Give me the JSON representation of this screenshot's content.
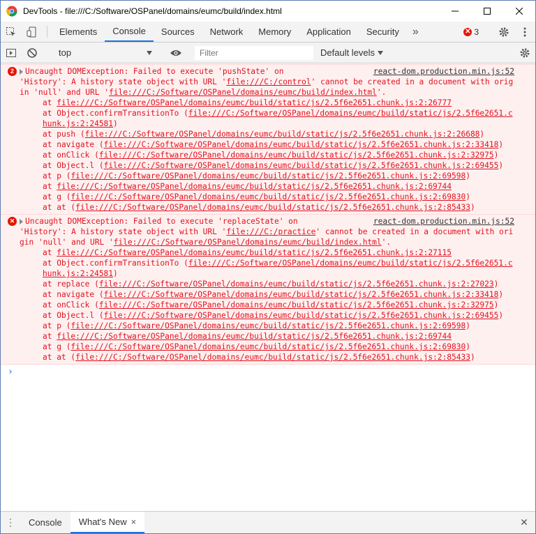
{
  "window": {
    "title": "DevTools - file:///C:/Software/OSPanel/domains/eumc/build/index.html",
    "minimize": "—",
    "maximize": "☐",
    "close": "✕"
  },
  "tabs": [
    {
      "label": "Elements"
    },
    {
      "label": "Console"
    },
    {
      "label": "Sources"
    },
    {
      "label": "Network"
    },
    {
      "label": "Memory"
    },
    {
      "label": "Application"
    },
    {
      "label": "Security"
    }
  ],
  "more_tabs": "»",
  "error_count": "3",
  "toolbar": {
    "context": "top",
    "filter_placeholder": "Filter",
    "levels": "Default levels"
  },
  "messages": [
    {
      "count": "2",
      "header": "Uncaught DOMException: Failed to execute 'pushState' on",
      "source": "react-dom.production.min.js:52",
      "body": [
        {
          "t": "'History': A history state object with URL '"
        },
        {
          "t": "file:///C:/control",
          "u": true
        },
        {
          "t": "' cannot be created in a document with origin 'null' and URL '"
        },
        {
          "t": "file:///C:/Software/OSPanel/domains/eumc/build/index.html",
          "u": true
        },
        {
          "t": "'."
        }
      ],
      "stack": [
        {
          "fn": "at ",
          "loc": "file:///C:/Software/OSPanel/domains/eumc/build/static/js/2.5f6e2651.chunk.js:2:26777",
          "paren": false
        },
        {
          "fn": "at Object.confirmTransitionTo ",
          "loc": "file:///C:/Software/OSPanel/domains/eumc/build/static/js/2.5f6e2651.chunk.js:2:24581",
          "paren": true
        },
        {
          "fn": "at push ",
          "loc": "file:///C:/Software/OSPanel/domains/eumc/build/static/js/2.5f6e2651.chunk.js:2:26688",
          "paren": true
        },
        {
          "fn": "at navigate ",
          "loc": "file:///C:/Software/OSPanel/domains/eumc/build/static/js/2.5f6e2651.chunk.js:2:33418",
          "paren": true
        },
        {
          "fn": "at onClick ",
          "loc": "file:///C:/Software/OSPanel/domains/eumc/build/static/js/2.5f6e2651.chunk.js:2:32975",
          "paren": true
        },
        {
          "fn": "at Object.l ",
          "loc": "file:///C:/Software/OSPanel/domains/eumc/build/static/js/2.5f6e2651.chunk.js:2:69455",
          "paren": true
        },
        {
          "fn": "at p ",
          "loc": "file:///C:/Software/OSPanel/domains/eumc/build/static/js/2.5f6e2651.chunk.js:2:69598",
          "paren": true
        },
        {
          "fn": "at ",
          "loc": "file:///C:/Software/OSPanel/domains/eumc/build/static/js/2.5f6e2651.chunk.js:2:69744",
          "paren": false
        },
        {
          "fn": "at g ",
          "loc": "file:///C:/Software/OSPanel/domains/eumc/build/static/js/2.5f6e2651.chunk.js:2:69830",
          "paren": true
        },
        {
          "fn": "at at ",
          "loc": "file:///C:/Software/OSPanel/domains/eumc/build/static/js/2.5f6e2651.chunk.js:2:85433",
          "paren": true
        }
      ]
    },
    {
      "count": "",
      "header": "Uncaught DOMException: Failed to execute 'replaceState' on",
      "source": "react-dom.production.min.js:52",
      "body": [
        {
          "t": "'History': A history state object with URL '"
        },
        {
          "t": "file:///C:/practice",
          "u": true
        },
        {
          "t": "' cannot be created in a document with origin 'null' and URL '"
        },
        {
          "t": "file:///C:/Software/OSPanel/domains/eumc/build/index.html",
          "u": true
        },
        {
          "t": "'."
        }
      ],
      "stack": [
        {
          "fn": "at ",
          "loc": "file:///C:/Software/OSPanel/domains/eumc/build/static/js/2.5f6e2651.chunk.js:2:27115",
          "paren": false
        },
        {
          "fn": "at Object.confirmTransitionTo ",
          "loc": "file:///C:/Software/OSPanel/domains/eumc/build/static/js/2.5f6e2651.chunk.js:2:24581",
          "paren": true
        },
        {
          "fn": "at replace ",
          "loc": "file:///C:/Software/OSPanel/domains/eumc/build/static/js/2.5f6e2651.chunk.js:2:27023",
          "paren": true
        },
        {
          "fn": "at navigate ",
          "loc": "file:///C:/Software/OSPanel/domains/eumc/build/static/js/2.5f6e2651.chunk.js:2:33418",
          "paren": true
        },
        {
          "fn": "at onClick ",
          "loc": "file:///C:/Software/OSPanel/domains/eumc/build/static/js/2.5f6e2651.chunk.js:2:32975",
          "paren": true
        },
        {
          "fn": "at Object.l ",
          "loc": "file:///C:/Software/OSPanel/domains/eumc/build/static/js/2.5f6e2651.chunk.js:2:69455",
          "paren": true
        },
        {
          "fn": "at p ",
          "loc": "file:///C:/Software/OSPanel/domains/eumc/build/static/js/2.5f6e2651.chunk.js:2:69598",
          "paren": true
        },
        {
          "fn": "at ",
          "loc": "file:///C:/Software/OSPanel/domains/eumc/build/static/js/2.5f6e2651.chunk.js:2:69744",
          "paren": false
        },
        {
          "fn": "at g ",
          "loc": "file:///C:/Software/OSPanel/domains/eumc/build/static/js/2.5f6e2651.chunk.js:2:69830",
          "paren": true
        },
        {
          "fn": "at at ",
          "loc": "file:///C:/Software/OSPanel/domains/eumc/build/static/js/2.5f6e2651.chunk.js:2:85433",
          "paren": true
        }
      ]
    }
  ],
  "prompt": "›",
  "drawer": {
    "menu": "⋮",
    "tabs": [
      {
        "label": "Console"
      },
      {
        "label": "What's New"
      }
    ],
    "tab_close": "×",
    "close": "✕"
  },
  "colors": {
    "error_text": "#e0131e",
    "error_bg": "#fff0f0",
    "accent": "#1a73e8"
  }
}
